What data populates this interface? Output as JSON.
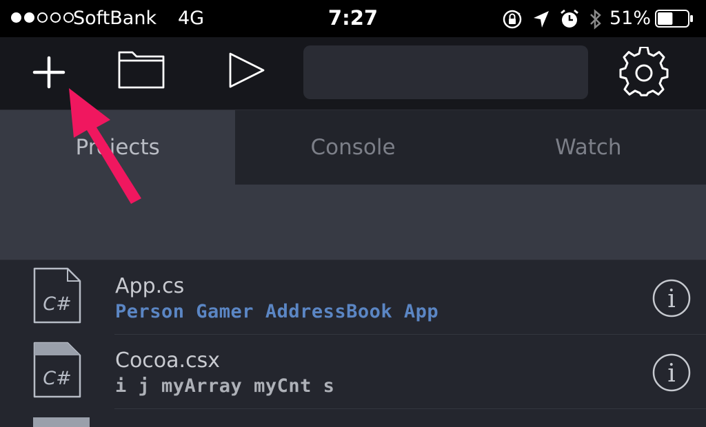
{
  "status_bar": {
    "carrier": "SoftBank",
    "network": "4G",
    "time": "7:27",
    "battery_percent": "51%",
    "battery_level": 0.51,
    "signal_bars_filled": 2,
    "signal_bars_total": 5,
    "icons": [
      "orientation-lock-icon",
      "location-arrow-icon",
      "alarm-icon",
      "bluetooth-icon"
    ]
  },
  "toolbar": {
    "buttons": [
      "add-icon",
      "folder-icon",
      "play-icon",
      "gear-icon"
    ],
    "search_value": "",
    "search_placeholder": ""
  },
  "tabs": [
    {
      "label": "Projects",
      "active": true
    },
    {
      "label": "Console",
      "active": false
    },
    {
      "label": "Watch",
      "active": false
    }
  ],
  "files": [
    {
      "name": "App.cs",
      "symbols": "Person Gamer AddressBook App",
      "icon_label": "C#",
      "symbol_color": "#5b86c4"
    },
    {
      "name": "Cocoa.csx",
      "symbols": "i j myArray myCnt s",
      "icon_label": "C#",
      "symbol_color": "#aeb1b8"
    }
  ],
  "colors": {
    "accent_arrow": "#f0175f",
    "tab_active_bg": "#373a44",
    "list_bg": "#24262e"
  }
}
